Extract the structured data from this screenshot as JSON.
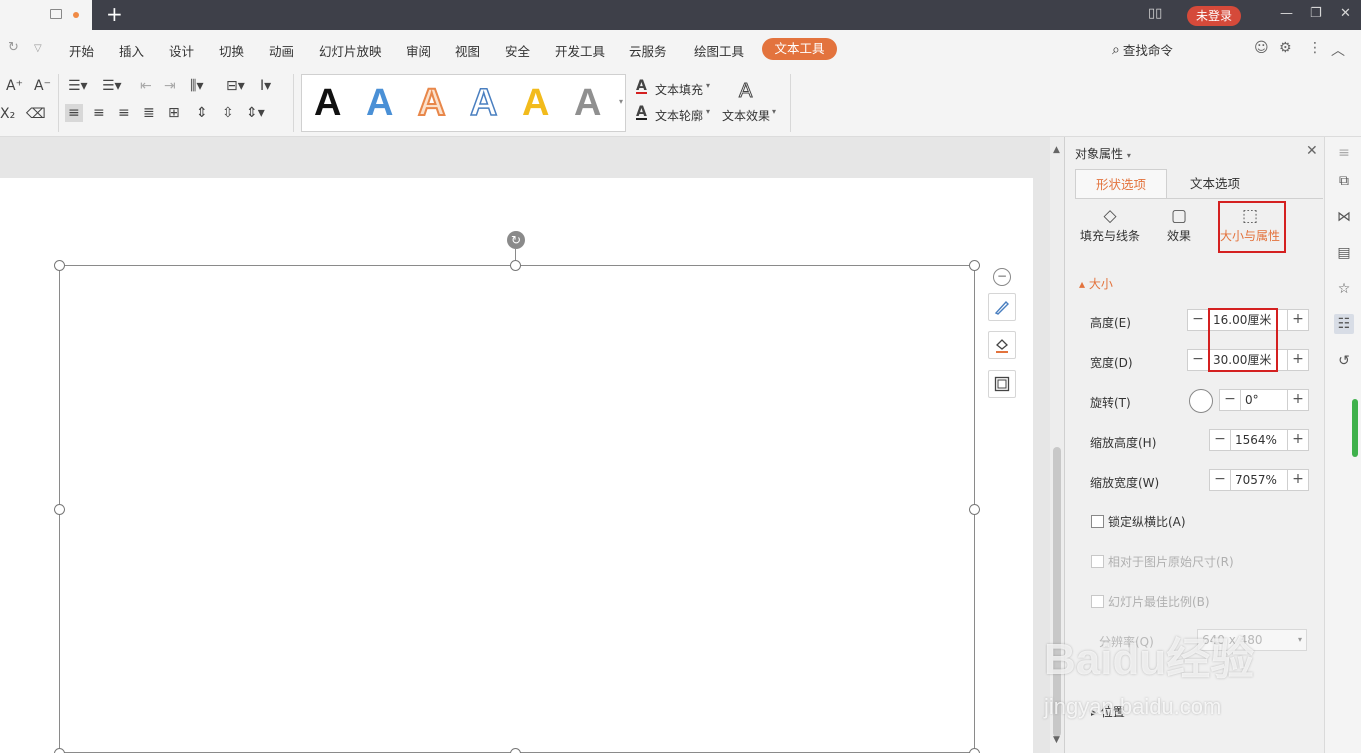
{
  "titlebar": {
    "login_label": "未登录",
    "new_tab_symbol": "+"
  },
  "menubar": {
    "items": [
      "开始",
      "插入",
      "设计",
      "切换",
      "动画",
      "幻灯片放映",
      "审阅",
      "视图",
      "安全",
      "开发工具",
      "云服务",
      "绘图工具"
    ],
    "active_tab": "文本工具",
    "search_label": "查找命令",
    "accent_color": "#e3733d"
  },
  "ribbon": {
    "wordart_letter": "A",
    "wordart_styles": [
      "black",
      "blue",
      "orange-outline",
      "blue-outline",
      "gold",
      "gray"
    ],
    "text_fill_label": "文本填充",
    "text_outline_label": "文本轮廓",
    "text_effect_label": "文本效果"
  },
  "pane": {
    "title": "对象属性",
    "tabs": [
      "形状选项",
      "文本选项"
    ],
    "sub_tabs": [
      "填充与线条",
      "效果",
      "大小与属性"
    ],
    "section_size": "大小",
    "height_label": "高度(E)",
    "height_value": "16.00厘米",
    "width_label": "宽度(D)",
    "width_value": "30.00厘米",
    "rotation_label": "旋转(T)",
    "rotation_value": "0°",
    "scale_height_label": "缩放高度(H)",
    "scale_height_value": "1564%",
    "scale_width_label": "缩放宽度(W)",
    "scale_width_value": "7057%",
    "lock_ratio_label": "锁定纵横比(A)",
    "relative_original_label": "相对于图片原始尺寸(R)",
    "best_ratio_label": "幻灯片最佳比例(B)",
    "resolution_label": "分辨率(Q)",
    "resolution_value": "640 x 480",
    "position_label": "位置"
  },
  "watermark": {
    "text": "Baidu经验",
    "url": "jingyan.baidu.com"
  }
}
